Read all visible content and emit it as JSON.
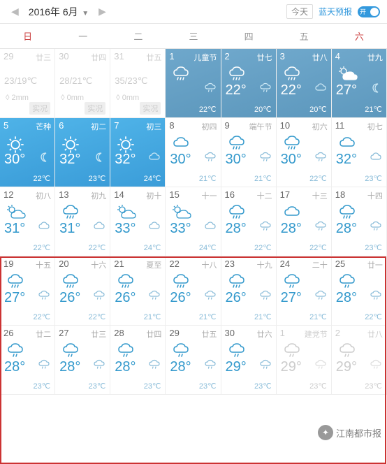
{
  "header": {
    "prev": "◀",
    "next": "▶",
    "month": "2016年 6月",
    "dropdown": "▼",
    "today": "今天",
    "blueskyLabel": "蓝天预报",
    "toggleText": "开"
  },
  "weekdays": [
    "日",
    "一",
    "二",
    "三",
    "四",
    "五",
    "六"
  ],
  "cells": [
    {
      "day": "29",
      "lunar": "廿三",
      "type": "observed gray",
      "obs1": "23/19℃",
      "obs2": "◊  2mm",
      "obs3": "实况"
    },
    {
      "day": "30",
      "lunar": "廿四",
      "type": "observed gray",
      "obs1": "28/21℃",
      "obs2": "◊  0mm",
      "obs3": "实况"
    },
    {
      "day": "31",
      "lunar": "廿五",
      "type": "observed gray",
      "obs1": "35/23℃",
      "obs2": "◊  0mm",
      "obs3": "实况"
    },
    {
      "day": "1",
      "lunar": "儿童节",
      "type": "bluebox",
      "icon": "rain-mod",
      "hi": "",
      "lo": "22℃",
      "smIcon": "rain-sm"
    },
    {
      "day": "2",
      "lunar": "廿七",
      "type": "bluebox",
      "icon": "rain-mod",
      "hi": "22°",
      "lo": "20℃",
      "smIcon": "rain-sm"
    },
    {
      "day": "3",
      "lunar": "廿八",
      "type": "bluebox",
      "icon": "rain-mod",
      "hi": "22°",
      "lo": "20℃",
      "smIcon": "cloud-sm"
    },
    {
      "day": "4",
      "lunar": "廿九",
      "type": "bluebox",
      "icon": "partly",
      "hi": "27°",
      "lo": "21℃",
      "smIcon": "moon"
    },
    {
      "day": "5",
      "lunar": "芒种",
      "type": "blue",
      "icon": "sunny",
      "hi": "30°",
      "lo": "22℃",
      "smIcon": "moon"
    },
    {
      "day": "6",
      "lunar": "初二",
      "type": "blue",
      "icon": "sunny",
      "hi": "32°",
      "lo": "23℃",
      "smIcon": "moon"
    },
    {
      "day": "7",
      "lunar": "初三",
      "type": "blue",
      "icon": "sunny",
      "hi": "32°",
      "lo": "24℃",
      "smIcon": "cloud-sm"
    },
    {
      "day": "8",
      "lunar": "初四",
      "type": "normal",
      "icon": "cloud",
      "hi": "30°",
      "lo": "21℃",
      "smIcon": "rain-sm"
    },
    {
      "day": "9",
      "lunar": "端午节",
      "type": "normal",
      "icon": "rain-mod",
      "hi": "30°",
      "lo": "21℃",
      "smIcon": "rain-sm"
    },
    {
      "day": "10",
      "lunar": "初六",
      "type": "normal",
      "icon": "rain-mod",
      "hi": "30°",
      "lo": "22℃",
      "smIcon": "rain-sm"
    },
    {
      "day": "11",
      "lunar": "初七",
      "type": "normal",
      "icon": "cloud",
      "hi": "32°",
      "lo": "23℃",
      "smIcon": "cloud-sm"
    },
    {
      "day": "12",
      "lunar": "初八",
      "type": "normal",
      "icon": "partly",
      "hi": "31°",
      "lo": "22℃",
      "smIcon": "cloud-sm"
    },
    {
      "day": "13",
      "lunar": "初九",
      "type": "normal",
      "icon": "rain-mod",
      "hi": "31°",
      "lo": "22℃",
      "smIcon": "cloud-sm"
    },
    {
      "day": "14",
      "lunar": "初十",
      "type": "normal",
      "icon": "partly",
      "hi": "33°",
      "lo": "24℃",
      "smIcon": "cloud-sm"
    },
    {
      "day": "15",
      "lunar": "十一",
      "type": "normal",
      "icon": "partly",
      "hi": "33°",
      "lo": "24℃",
      "smIcon": "cloud-sm"
    },
    {
      "day": "16",
      "lunar": "十二",
      "type": "normal",
      "icon": "rain-mod",
      "hi": "28°",
      "lo": "22℃",
      "smIcon": "rain-sm"
    },
    {
      "day": "17",
      "lunar": "十三",
      "type": "normal",
      "icon": "cloud",
      "hi": "28°",
      "lo": "22℃",
      "smIcon": "rain-sm"
    },
    {
      "day": "18",
      "lunar": "十四",
      "type": "normal",
      "icon": "rain-mod",
      "hi": "28°",
      "lo": "23℃",
      "smIcon": "rain-sm"
    },
    {
      "day": "19",
      "lunar": "十五",
      "type": "normal",
      "icon": "rain-mod",
      "hi": "27°",
      "lo": "22℃",
      "smIcon": "rain-sm"
    },
    {
      "day": "20",
      "lunar": "十六",
      "type": "normal",
      "icon": "rain-mod",
      "hi": "26°",
      "lo": "22℃",
      "smIcon": "rain-sm"
    },
    {
      "day": "21",
      "lunar": "夏至",
      "type": "normal",
      "icon": "rain-mod",
      "hi": "26°",
      "lo": "21℃",
      "smIcon": "rain-sm"
    },
    {
      "day": "22",
      "lunar": "十八",
      "type": "normal",
      "icon": "rain-mod",
      "hi": "26°",
      "lo": "21℃",
      "smIcon": "rain-sm"
    },
    {
      "day": "23",
      "lunar": "十九",
      "type": "normal",
      "icon": "rain-mod",
      "hi": "26°",
      "lo": "21℃",
      "smIcon": "rain-sm"
    },
    {
      "day": "24",
      "lunar": "二十",
      "type": "normal",
      "icon": "rain-lt",
      "hi": "27°",
      "lo": "21℃",
      "smIcon": "rain-sm"
    },
    {
      "day": "25",
      "lunar": "廿一",
      "type": "normal",
      "icon": "rain-lt",
      "hi": "28°",
      "lo": "22℃",
      "smIcon": "rain-sm"
    },
    {
      "day": "26",
      "lunar": "廿二",
      "type": "normal",
      "icon": "rain-lt",
      "hi": "28°",
      "lo": "23℃",
      "smIcon": "rain-sm"
    },
    {
      "day": "27",
      "lunar": "廿三",
      "type": "normal",
      "icon": "rain-lt",
      "hi": "28°",
      "lo": "23℃",
      "smIcon": "rain-sm"
    },
    {
      "day": "28",
      "lunar": "廿四",
      "type": "normal",
      "icon": "rain-lt",
      "hi": "28°",
      "lo": "23℃",
      "smIcon": "rain-sm"
    },
    {
      "day": "29",
      "lunar": "廿五",
      "type": "normal",
      "icon": "rain-lt",
      "hi": "28°",
      "lo": "23℃",
      "smIcon": "rain-sm"
    },
    {
      "day": "30",
      "lunar": "廿六",
      "type": "normal",
      "icon": "rain-lt",
      "hi": "29°",
      "lo": "23℃",
      "smIcon": "rain-sm"
    },
    {
      "day": "1",
      "lunar": "建党节",
      "type": "gray",
      "icon": "rain-lt",
      "hi": "29°",
      "lo": "23℃",
      "smIcon": "rain-sm"
    },
    {
      "day": "2",
      "lunar": "廿八",
      "type": "gray",
      "icon": "rain-lt",
      "hi": "29°",
      "lo": "23℃",
      "smIcon": "rain-sm"
    }
  ],
  "watermark": {
    "text": "江南都市报"
  }
}
